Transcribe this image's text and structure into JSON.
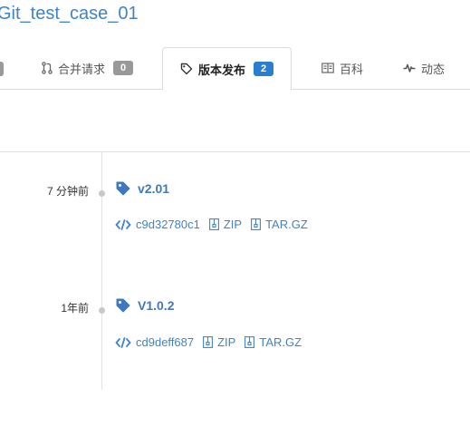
{
  "repo": {
    "title": "Git_test_case_01"
  },
  "tabs": [
    {
      "label": "合并请求",
      "count": "0",
      "icon": "pull-request-icon"
    },
    {
      "label": "版本发布",
      "count": "2",
      "icon": "tag-icon",
      "active": true
    },
    {
      "label": "百科",
      "icon": "book-icon"
    },
    {
      "label": "动态",
      "icon": "pulse-icon"
    }
  ],
  "releases": [
    {
      "time": "7 分钟前",
      "tag": "v2.01",
      "commit": "c9d32780c1",
      "zip": "ZIP",
      "tar": "TAR.GZ"
    },
    {
      "time": "1年前",
      "tag": "V1.0.2",
      "commit": "cd9deff687",
      "zip": "ZIP",
      "tar": "TAR.GZ"
    }
  ],
  "colors": {
    "link": "#4183c4",
    "active_badge": "#2a7ed2",
    "badge": "#999999"
  }
}
